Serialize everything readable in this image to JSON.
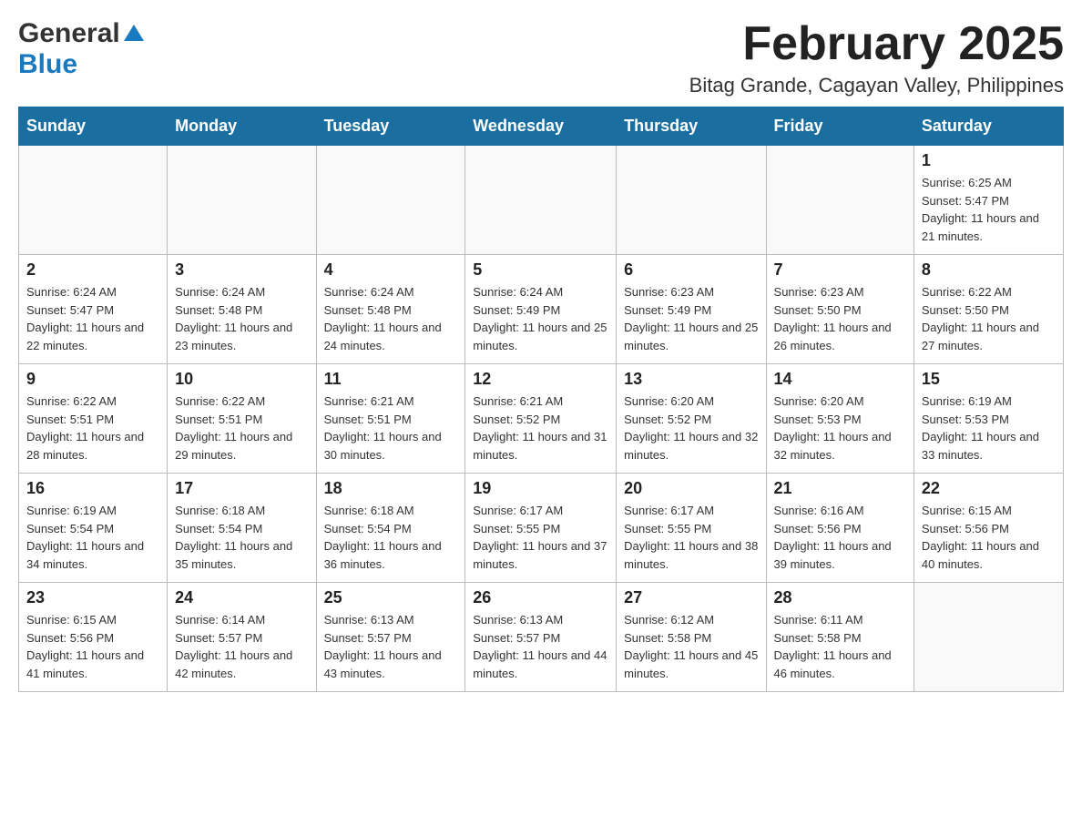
{
  "logo": {
    "general": "General",
    "blue": "Blue"
  },
  "header": {
    "month": "February 2025",
    "location": "Bitag Grande, Cagayan Valley, Philippines"
  },
  "days_of_week": [
    "Sunday",
    "Monday",
    "Tuesday",
    "Wednesday",
    "Thursday",
    "Friday",
    "Saturday"
  ],
  "weeks": [
    {
      "days": [
        {
          "number": "",
          "info": ""
        },
        {
          "number": "",
          "info": ""
        },
        {
          "number": "",
          "info": ""
        },
        {
          "number": "",
          "info": ""
        },
        {
          "number": "",
          "info": ""
        },
        {
          "number": "",
          "info": ""
        },
        {
          "number": "1",
          "info": "Sunrise: 6:25 AM\nSunset: 5:47 PM\nDaylight: 11 hours and 21 minutes."
        }
      ]
    },
    {
      "days": [
        {
          "number": "2",
          "info": "Sunrise: 6:24 AM\nSunset: 5:47 PM\nDaylight: 11 hours and 22 minutes."
        },
        {
          "number": "3",
          "info": "Sunrise: 6:24 AM\nSunset: 5:48 PM\nDaylight: 11 hours and 23 minutes."
        },
        {
          "number": "4",
          "info": "Sunrise: 6:24 AM\nSunset: 5:48 PM\nDaylight: 11 hours and 24 minutes."
        },
        {
          "number": "5",
          "info": "Sunrise: 6:24 AM\nSunset: 5:49 PM\nDaylight: 11 hours and 25 minutes."
        },
        {
          "number": "6",
          "info": "Sunrise: 6:23 AM\nSunset: 5:49 PM\nDaylight: 11 hours and 25 minutes."
        },
        {
          "number": "7",
          "info": "Sunrise: 6:23 AM\nSunset: 5:50 PM\nDaylight: 11 hours and 26 minutes."
        },
        {
          "number": "8",
          "info": "Sunrise: 6:22 AM\nSunset: 5:50 PM\nDaylight: 11 hours and 27 minutes."
        }
      ]
    },
    {
      "days": [
        {
          "number": "9",
          "info": "Sunrise: 6:22 AM\nSunset: 5:51 PM\nDaylight: 11 hours and 28 minutes."
        },
        {
          "number": "10",
          "info": "Sunrise: 6:22 AM\nSunset: 5:51 PM\nDaylight: 11 hours and 29 minutes."
        },
        {
          "number": "11",
          "info": "Sunrise: 6:21 AM\nSunset: 5:51 PM\nDaylight: 11 hours and 30 minutes."
        },
        {
          "number": "12",
          "info": "Sunrise: 6:21 AM\nSunset: 5:52 PM\nDaylight: 11 hours and 31 minutes."
        },
        {
          "number": "13",
          "info": "Sunrise: 6:20 AM\nSunset: 5:52 PM\nDaylight: 11 hours and 32 minutes."
        },
        {
          "number": "14",
          "info": "Sunrise: 6:20 AM\nSunset: 5:53 PM\nDaylight: 11 hours and 32 minutes."
        },
        {
          "number": "15",
          "info": "Sunrise: 6:19 AM\nSunset: 5:53 PM\nDaylight: 11 hours and 33 minutes."
        }
      ]
    },
    {
      "days": [
        {
          "number": "16",
          "info": "Sunrise: 6:19 AM\nSunset: 5:54 PM\nDaylight: 11 hours and 34 minutes."
        },
        {
          "number": "17",
          "info": "Sunrise: 6:18 AM\nSunset: 5:54 PM\nDaylight: 11 hours and 35 minutes."
        },
        {
          "number": "18",
          "info": "Sunrise: 6:18 AM\nSunset: 5:54 PM\nDaylight: 11 hours and 36 minutes."
        },
        {
          "number": "19",
          "info": "Sunrise: 6:17 AM\nSunset: 5:55 PM\nDaylight: 11 hours and 37 minutes."
        },
        {
          "number": "20",
          "info": "Sunrise: 6:17 AM\nSunset: 5:55 PM\nDaylight: 11 hours and 38 minutes."
        },
        {
          "number": "21",
          "info": "Sunrise: 6:16 AM\nSunset: 5:56 PM\nDaylight: 11 hours and 39 minutes."
        },
        {
          "number": "22",
          "info": "Sunrise: 6:15 AM\nSunset: 5:56 PM\nDaylight: 11 hours and 40 minutes."
        }
      ]
    },
    {
      "days": [
        {
          "number": "23",
          "info": "Sunrise: 6:15 AM\nSunset: 5:56 PM\nDaylight: 11 hours and 41 minutes."
        },
        {
          "number": "24",
          "info": "Sunrise: 6:14 AM\nSunset: 5:57 PM\nDaylight: 11 hours and 42 minutes."
        },
        {
          "number": "25",
          "info": "Sunrise: 6:13 AM\nSunset: 5:57 PM\nDaylight: 11 hours and 43 minutes."
        },
        {
          "number": "26",
          "info": "Sunrise: 6:13 AM\nSunset: 5:57 PM\nDaylight: 11 hours and 44 minutes."
        },
        {
          "number": "27",
          "info": "Sunrise: 6:12 AM\nSunset: 5:58 PM\nDaylight: 11 hours and 45 minutes."
        },
        {
          "number": "28",
          "info": "Sunrise: 6:11 AM\nSunset: 5:58 PM\nDaylight: 11 hours and 46 minutes."
        },
        {
          "number": "",
          "info": ""
        }
      ]
    }
  ]
}
